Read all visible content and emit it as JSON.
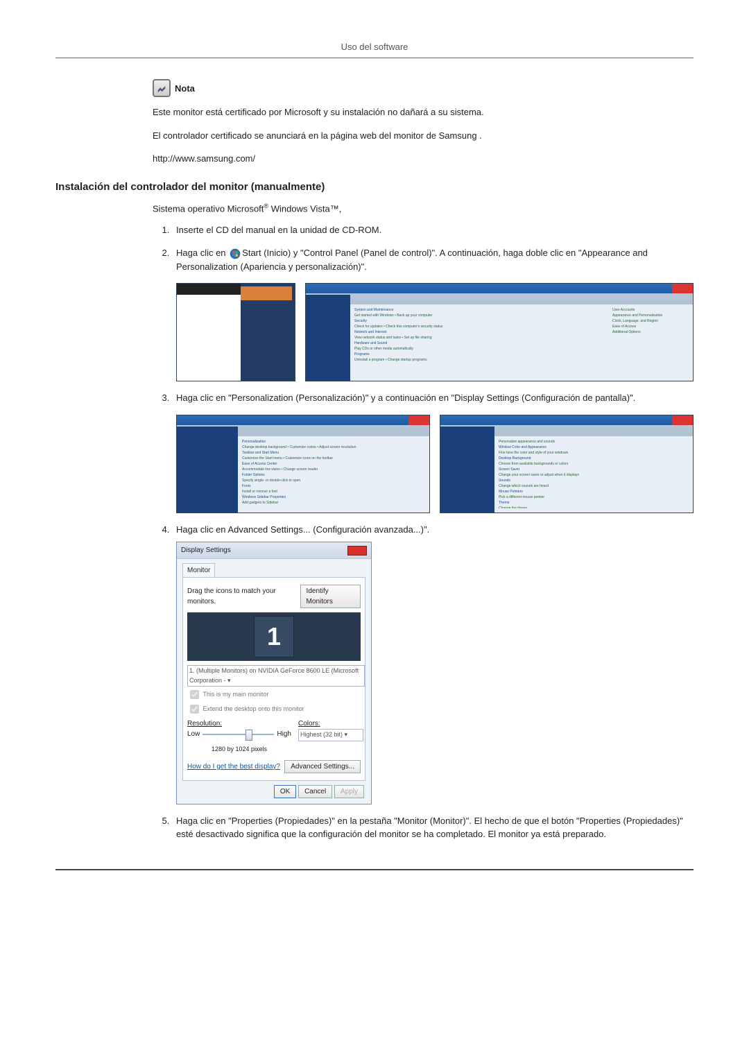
{
  "header": {
    "title": "Uso del software"
  },
  "note": {
    "label": "Nota",
    "line1": "Este monitor está certificado por Microsoft y su instalación no dañará a su sistema.",
    "line2": "El controlador certificado se anunciará en la página web del monitor de Samsung .",
    "url": "http://www.samsung.com/"
  },
  "section": {
    "heading": "Instalación del controlador del monitor (manualmente)",
    "intro_prefix": "Sistema operativo Microsoft",
    "intro_suffix": " Windows Vista™,"
  },
  "steps": {
    "s1": "Inserte el CD del manual en la unidad de CD-ROM.",
    "s2_a": "Haga clic en ",
    "s2_b": "Start (Inicio) y \"Control Panel (Panel de control)\". A continuación, haga doble clic en \"Appearance and Personalization (Apariencia y personalización)\".",
    "s3": "Haga clic en \"Personalization (Personalización)\" y a continuación en \"Display Settings (Configuración de pantalla)\".",
    "s4": "Haga clic en Advanced Settings... (Configuración avanzada...)\".",
    "s5": "Haga clic en \"Properties (Propiedades)\" en la pestaña \"Monitor (Monitor)\". El hecho de que el botón \"Properties (Propiedades)\" esté desactivado significa que la configuración del monitor se ha completado. El monitor ya está preparado."
  },
  "display_settings": {
    "title": "Display Settings",
    "tab": "Monitor",
    "drag_text": "Drag the icons to match your monitors.",
    "identify": "Identify Monitors",
    "monitor_num": "1",
    "dropdown": "1. (Multiple Monitors) on NVIDIA GeForce 8600 LE (Microsoft Corporation - ▾",
    "chk_main": "This is my main monitor",
    "chk_extend": "Extend the desktop onto this monitor",
    "res_label": "Resolution:",
    "low": "Low",
    "high": "High",
    "res_value": "1280 by 1024 pixels",
    "colors_label": "Colors:",
    "colors_value": "Highest (32 bit)    ▾",
    "help_link": "How do I get the best display?",
    "advanced": "Advanced Settings...",
    "ok": "OK",
    "cancel": "Cancel",
    "apply": "Apply"
  }
}
